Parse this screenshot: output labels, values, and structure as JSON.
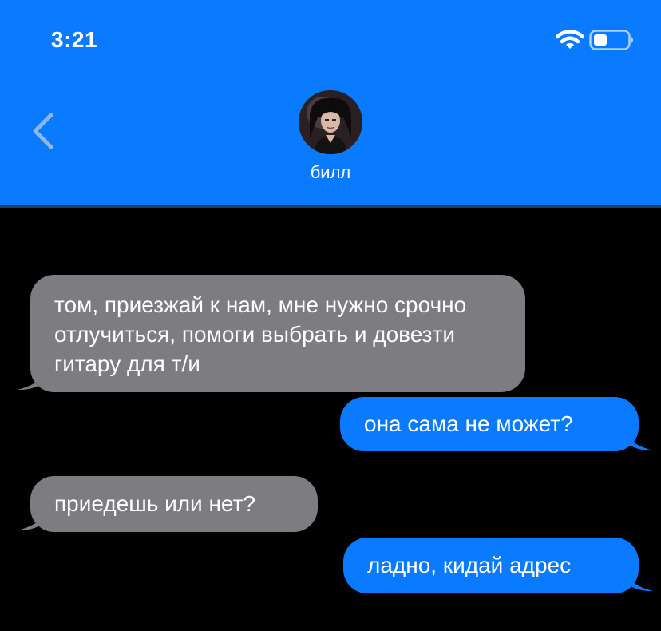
{
  "status_bar": {
    "time": "3:21"
  },
  "contact": {
    "name": "билл"
  },
  "messages": [
    {
      "from": "them",
      "text": "том, приезжай к нам, мне нужно срочно отлучиться, помоги выбрать и довезти гитару для т/и"
    },
    {
      "from": "me",
      "text": "она сама не может?"
    },
    {
      "from": "them",
      "text": "приедешь или нет?"
    },
    {
      "from": "me",
      "text": "ладно, кидай адрес"
    }
  ],
  "colors": {
    "header": "#0a7bff",
    "incoming_bubble": "#7d7c80",
    "outgoing_bubble": "#0a7bff",
    "background": "#000000"
  }
}
